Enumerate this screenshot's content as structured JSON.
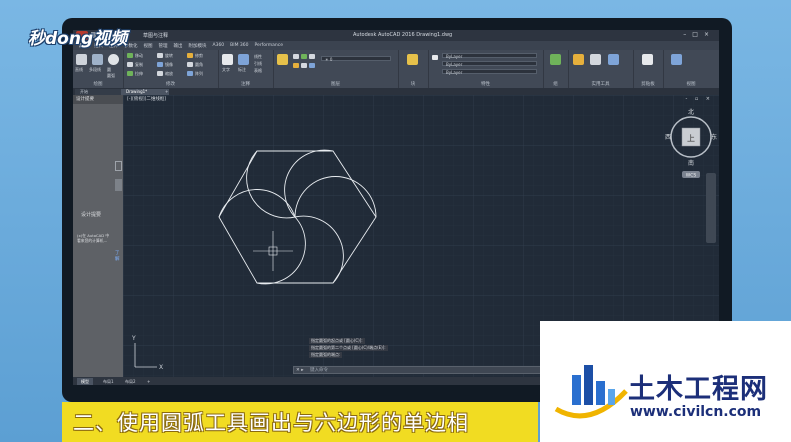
{
  "logo": {
    "text": "秒dong视频"
  },
  "app": {
    "title_workspace": "草图与注释",
    "document_title": "Autodesk AutoCAD 2016    Drawing1.dwg",
    "menu_tabs": [
      "默认",
      "插入",
      "注释",
      "参数化",
      "视图",
      "管理",
      "输出",
      "附加模块",
      "A360",
      "BIM 360",
      "Performance"
    ],
    "ribbon_groups": [
      "绘图",
      "修改",
      "注释",
      "图层",
      "块",
      "特性",
      "组",
      "实用工具",
      "剪贴板",
      "视图"
    ],
    "ribbon_draw_labels": [
      "直线",
      "多段线",
      "圆",
      "圆弧"
    ],
    "ribbon_modify_labels": [
      "移动",
      "旋转",
      "修剪",
      "复制",
      "镜像",
      "圆角",
      "拉伸",
      "缩放",
      "阵列"
    ],
    "ribbon_annot_labels": [
      "文字",
      "标注",
      "线性",
      "引线",
      "表格"
    ],
    "layer_values": [
      "ByLayer",
      "ByLayer",
      "ByLayer"
    ]
  },
  "file_tabs": {
    "start": "开始",
    "drawing": "Drawing1*"
  },
  "palette": {
    "title": "设计提要",
    "heading": "设计提要",
    "body": "(x)在 AutoCAD 中\n看来您的计算机…",
    "link": "了解"
  },
  "viewport": {
    "label": "[-][俯视][二维线框]",
    "controls": "- ▫ ×"
  },
  "viewcube": {
    "north": "北",
    "south": "南",
    "east": "东",
    "west": "西",
    "face": "上",
    "wcs": "WCS"
  },
  "command_history": [
    "指定圆弧的起点或 [圆心(C)]:",
    "指定圆弧的第二个点或 [圆心(C)/端点(E)]:",
    "指定圆弧的端点:"
  ],
  "command_input": {
    "placeholder": "键入命令"
  },
  "layout_tabs": [
    "模型",
    "布局1",
    "布局2"
  ],
  "caption": "二、使用圆弧工具画出与六边形的单边相",
  "watermark": {
    "brand": "土木工程网",
    "url": "www.civilcn.com"
  },
  "colors": {
    "accent_yellow": "#f1dc22",
    "bg_blue": "#67a9d9",
    "cad_bg": "#212b38",
    "drawing_line": "#e8ecf0"
  }
}
